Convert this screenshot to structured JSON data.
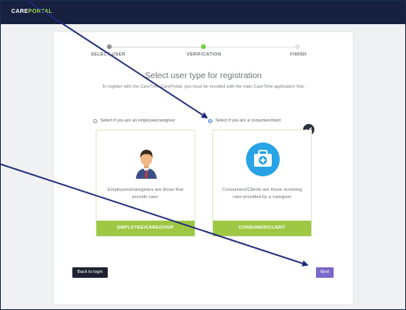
{
  "app": {
    "brand_primary": "CARE",
    "brand_secondary": "PORTAL"
  },
  "stepper": [
    {
      "label": "SELECT USER",
      "state": "done"
    },
    {
      "label": "VERIFICATION",
      "state": "active"
    },
    {
      "label": "FINISH",
      "state": "pending"
    }
  ],
  "main": {
    "title": "Select user type for registration",
    "subtitle": "To register with the CareTime CarePortal, you must be enrolled with the main CareTime application first."
  },
  "options": [
    {
      "radio_label": "Select if you are an employee/caregiver",
      "selected": false,
      "icon": "employee-avatar-icon",
      "description": "Employees/caregivers are those that provide care.",
      "button_label": "EMPLOYEE/CAREGIVER"
    },
    {
      "radio_label": "Select if you are a consumer/client",
      "selected": true,
      "icon": "first-aid-kit-icon",
      "description": "Consumers/Clients are those receiving care provided by a caregiver",
      "button_label": "CONSUMER/CLIENT"
    }
  ],
  "actions": {
    "back_label": "Back to login",
    "next_label": "Next"
  },
  "colors": {
    "header": "#182040",
    "accent_green": "#9ec744",
    "next_purple": "#7b68c8",
    "annotation": "#1e2a78"
  }
}
